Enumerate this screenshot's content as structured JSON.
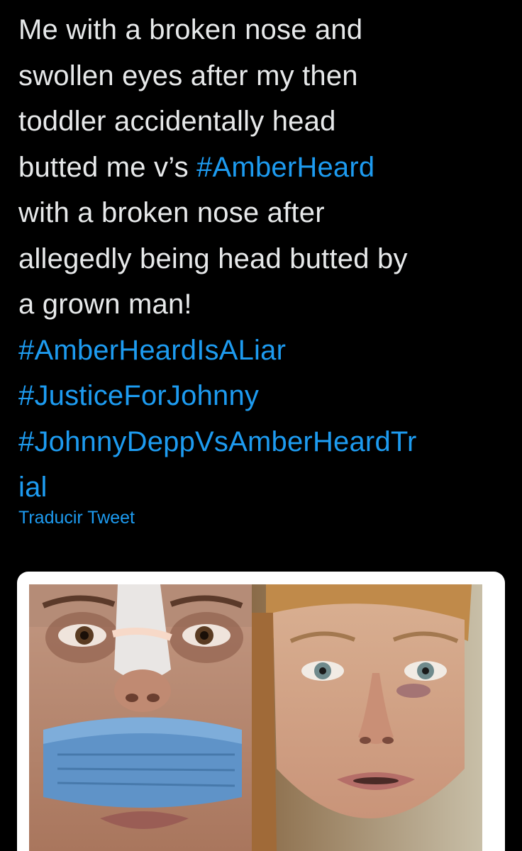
{
  "tweet": {
    "lines": [
      [
        {
          "text": "Me with a broken nose and",
          "tag": false
        }
      ],
      [
        {
          "text": "swollen eyes after my then",
          "tag": false
        }
      ],
      [
        {
          "text": "toddler accidentally head",
          "tag": false
        }
      ],
      [
        {
          "text": "butted me v’s ",
          "tag": false
        },
        {
          "text": "#AmberHeard",
          "tag": true
        }
      ],
      [
        {
          "text": "with a broken nose after",
          "tag": false
        }
      ],
      [
        {
          "text": "allegedly being head butted by",
          "tag": false
        }
      ],
      [
        {
          "text": "a grown man!",
          "tag": false
        }
      ],
      [
        {
          "text": "#AmberHeardIsALiar",
          "tag": true
        }
      ],
      [
        {
          "text": "#JusticeForJohnny",
          "tag": true
        }
      ],
      [
        {
          "text": "#JohnnyDeppVsAmberHeardTr",
          "tag": true
        }
      ],
      [
        {
          "text": "ial",
          "tag": true
        }
      ]
    ],
    "translate_label": "Traducir Tweet"
  },
  "media": {
    "photos": [
      {
        "name": "photo-bandaged-nose"
      },
      {
        "name": "photo-bruised-face"
      }
    ]
  },
  "colors": {
    "background": "#000000",
    "text": "#e7e9ea",
    "link": "#1d9bf0"
  }
}
